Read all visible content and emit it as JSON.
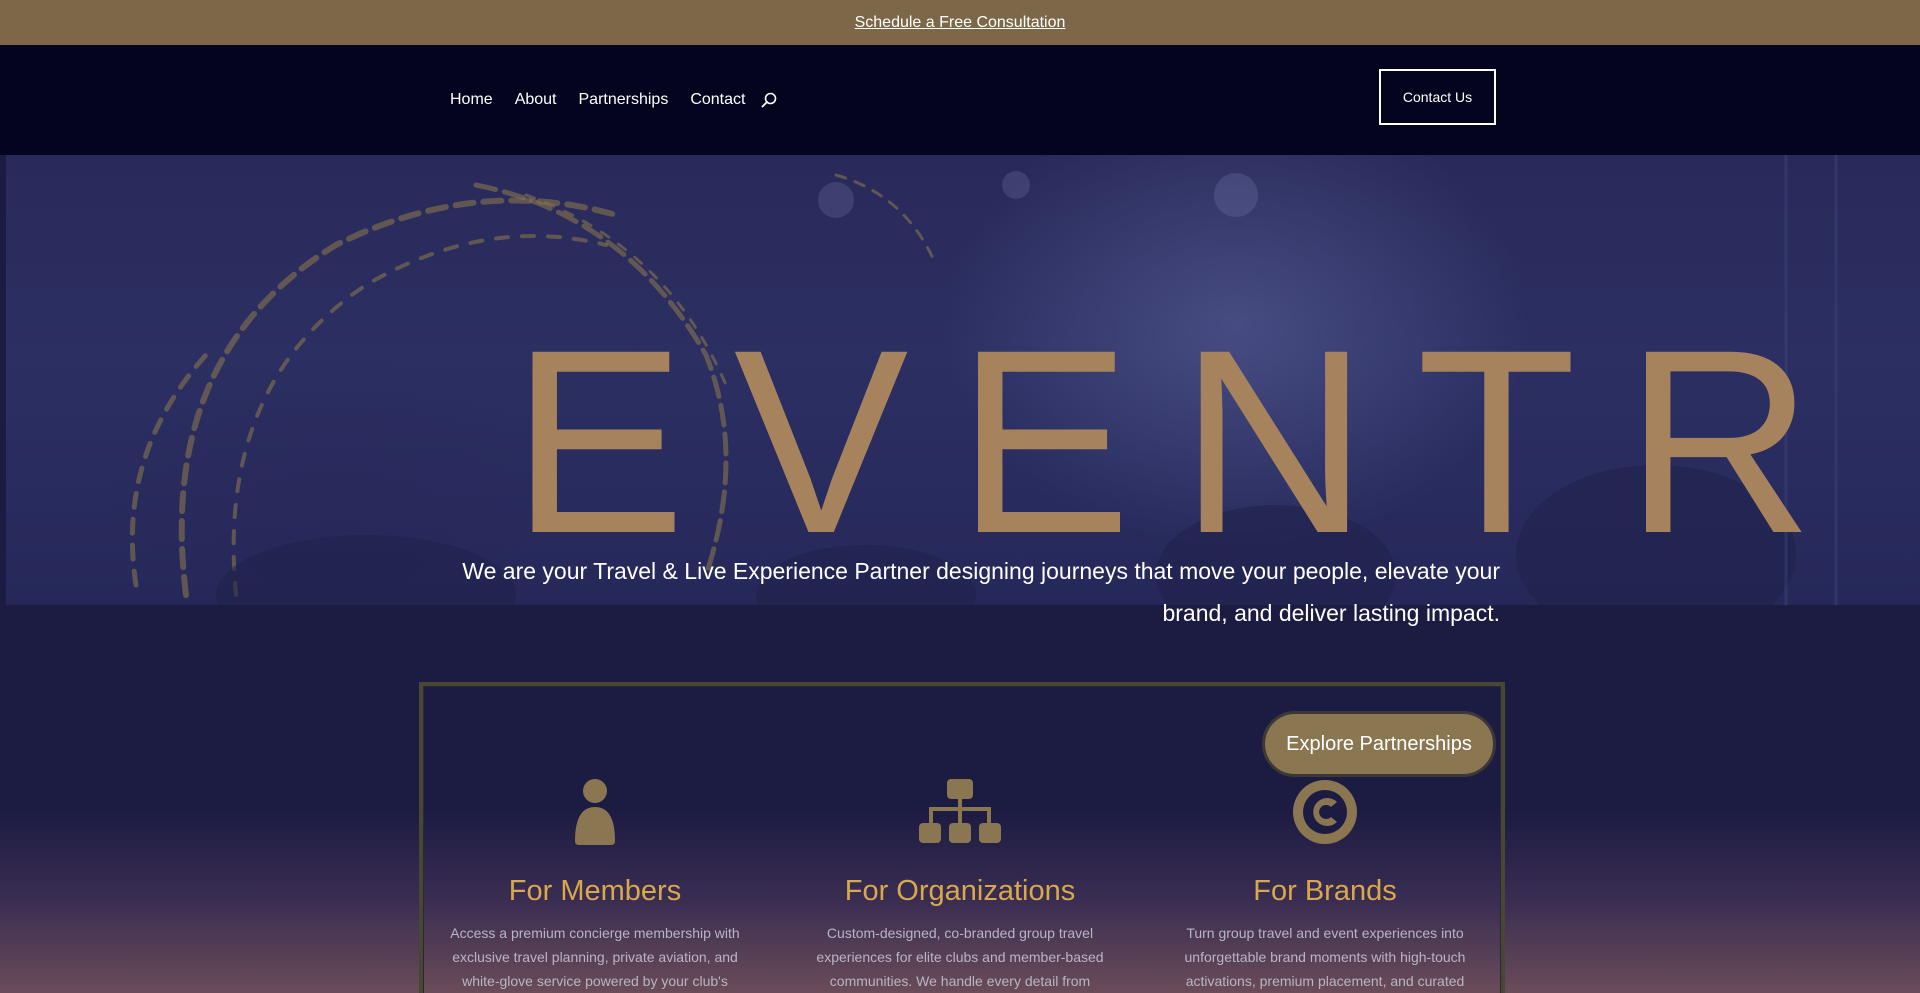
{
  "banner": {
    "link_text": "Schedule a Free Consultation"
  },
  "nav": {
    "items": [
      "Home",
      "About",
      "Partnerships",
      "Contact"
    ],
    "search_icon": "search-icon",
    "contact_button": "Contact Us"
  },
  "hero": {
    "wordmark": "EVENTRA",
    "tagline_line1": "We are your Travel & Live Experience Partner designing journeys that move your people, elevate your",
    "tagline_line2": "brand, and deliver lasting impact."
  },
  "partnerships": {
    "cta": "Explore Partnerships",
    "columns": [
      {
        "icon": "person-icon",
        "title": "For Members",
        "text_lines": [
          "Access a premium concierge membership with",
          "exclusive travel planning, private aviation, and",
          "white-glove service powered by your club's"
        ]
      },
      {
        "icon": "org-chart-icon",
        "title": "For Organizations",
        "text_lines": [
          "Custom-designed, co-branded group travel",
          "experiences for elite clubs and member-based",
          "communities. We handle every detail from"
        ]
      },
      {
        "icon": "copyright-icon",
        "title": "For Brands",
        "text_lines": [
          "Turn group travel and event experiences into",
          "unforgettable brand moments with high-touch",
          "activations, premium placement, and curated"
        ]
      }
    ]
  },
  "colors": {
    "banner": "#7c6849",
    "header": "#05041e",
    "gold": "#a7835d",
    "heading_gold": "#d9a84b",
    "background": "#1c1b42"
  }
}
